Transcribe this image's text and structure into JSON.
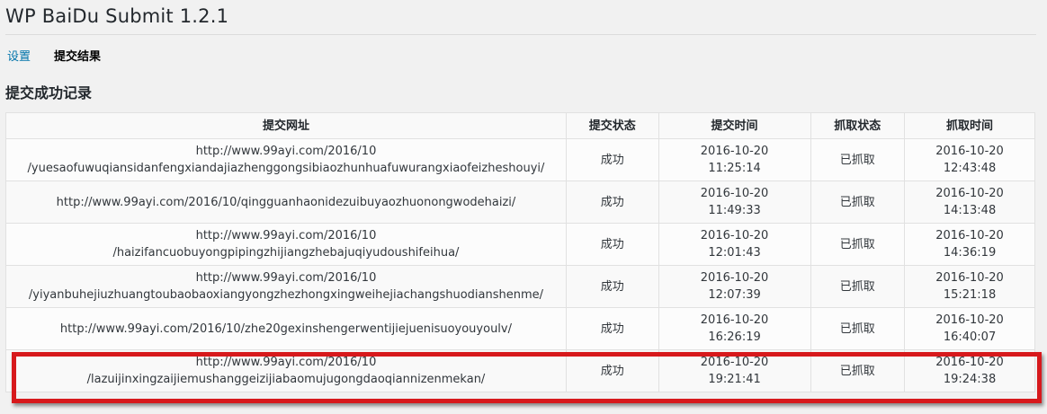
{
  "page": {
    "title": "WP BaiDu Submit 1.2.1"
  },
  "subnav": {
    "settings": "设置",
    "results": "提交结果"
  },
  "section": {
    "title": "提交成功记录"
  },
  "table": {
    "headers": [
      "提交网址",
      "提交状态",
      "提交时间",
      "抓取状态",
      "抓取时间"
    ],
    "rows": [
      {
        "url_line1": "http://www.99ayi.com/2016/10",
        "url_line2": "/yuesaofuwuqiansidanfengxiandajiazhenggongsibiaozhunhuafuwurangxiaofeizheshouyi/",
        "status": "成功",
        "submit_date": "2016-10-20",
        "submit_time": "11:25:14",
        "crawl_status": "已抓取",
        "crawl_date": "2016-10-20",
        "crawl_time": "12:43:48"
      },
      {
        "url_line1": "http://www.99ayi.com/2016/10/qingguanhaonidezuibuyaozhuonongwodehaizi/",
        "url_line2": "",
        "status": "成功",
        "submit_date": "2016-10-20",
        "submit_time": "11:49:33",
        "crawl_status": "已抓取",
        "crawl_date": "2016-10-20",
        "crawl_time": "14:13:48"
      },
      {
        "url_line1": "http://www.99ayi.com/2016/10",
        "url_line2": "/haizifancuobuyongpipingzhijiangzhebajuqiyudoushifeihua/",
        "status": "成功",
        "submit_date": "2016-10-20",
        "submit_time": "12:01:43",
        "crawl_status": "已抓取",
        "crawl_date": "2016-10-20",
        "crawl_time": "14:36:19"
      },
      {
        "url_line1": "http://www.99ayi.com/2016/10",
        "url_line2": "/yiyanbuhejiuzhuangtoubaobaoxiangyongzhezhongxingweihejiachangshuodianshenme/",
        "status": "成功",
        "submit_date": "2016-10-20",
        "submit_time": "12:07:39",
        "crawl_status": "已抓取",
        "crawl_date": "2016-10-20",
        "crawl_time": "15:21:18"
      },
      {
        "url_line1": "http://www.99ayi.com/2016/10/zhe20gexinshengerwentijiejuenisuoyouyoulv/",
        "url_line2": "",
        "status": "成功",
        "submit_date": "2016-10-20",
        "submit_time": "16:26:19",
        "crawl_status": "已抓取",
        "crawl_date": "2016-10-20",
        "crawl_time": "16:40:07"
      },
      {
        "url_line1": "http://www.99ayi.com/2016/10",
        "url_line2": "/lazuijinxingzaijiemushanggeizijiabaomujugongdaoqiannizenmekan/",
        "status": "成功",
        "submit_date": "2016-10-20",
        "submit_time": "19:21:41",
        "crawl_status": "已抓取",
        "crawl_date": "2016-10-20",
        "crawl_time": "19:24:38"
      }
    ]
  },
  "colors": {
    "link": "#0073aa",
    "highlight": "#d7191c"
  }
}
